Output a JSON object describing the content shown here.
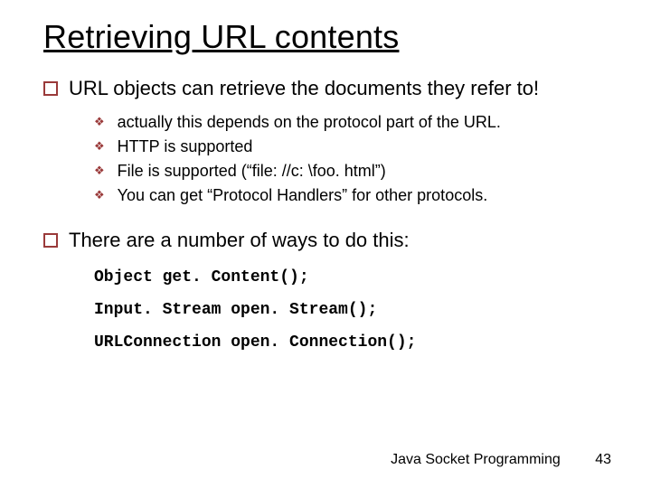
{
  "title": "Retrieving URL contents",
  "points": {
    "p1": "URL objects can retrieve the documents they refer to!",
    "subs": {
      "s1": "actually this depends on the protocol part of the URL.",
      "s2": "HTTP is supported",
      "s3": "File is supported (“file: //c: \\foo. html”)",
      "s4": "You can get “Protocol Handlers” for other protocols."
    },
    "p2": "There are a number of ways to do this:",
    "code": {
      "c1": "Object get. Content();",
      "c2": "Input. Stream open. Stream();",
      "c3": "URLConnection open. Connection();"
    }
  },
  "footer": {
    "label": "Java Socket Programming",
    "page": "43"
  }
}
